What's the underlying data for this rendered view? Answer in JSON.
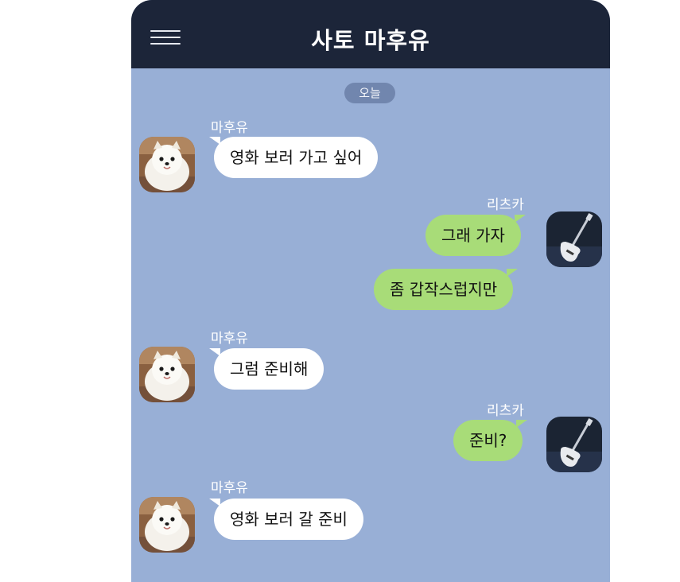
{
  "header": {
    "title": "사토 마후유",
    "menu_icon": "hamburger-menu-icon"
  },
  "date_divider": "오늘",
  "participants": {
    "other": {
      "name": "마후유",
      "avatar_icon": "white-pomeranian-dog-avatar"
    },
    "me": {
      "name": "리츠카",
      "avatar_icon": "electric-guitar-avatar"
    }
  },
  "messages": [
    {
      "sender": "마후유",
      "text": "영화 보러 가고 싶어"
    },
    {
      "sender": "리츠카",
      "text": "그래 가자"
    },
    {
      "sender": "리츠카",
      "text": "좀 갑작스럽지만"
    },
    {
      "sender": "마후유",
      "text": "그럼 준비해"
    },
    {
      "sender": "리츠카",
      "text": "준비?"
    },
    {
      "sender": "마후유",
      "text": "영화 보러 갈 준비"
    }
  ],
  "colors": {
    "header_bg": "#1C2539",
    "chat_bg": "#98AFD6",
    "incoming_bubble": "#FFFFFF",
    "outgoing_bubble": "#A8DC78",
    "date_pill": "#7186AE"
  }
}
